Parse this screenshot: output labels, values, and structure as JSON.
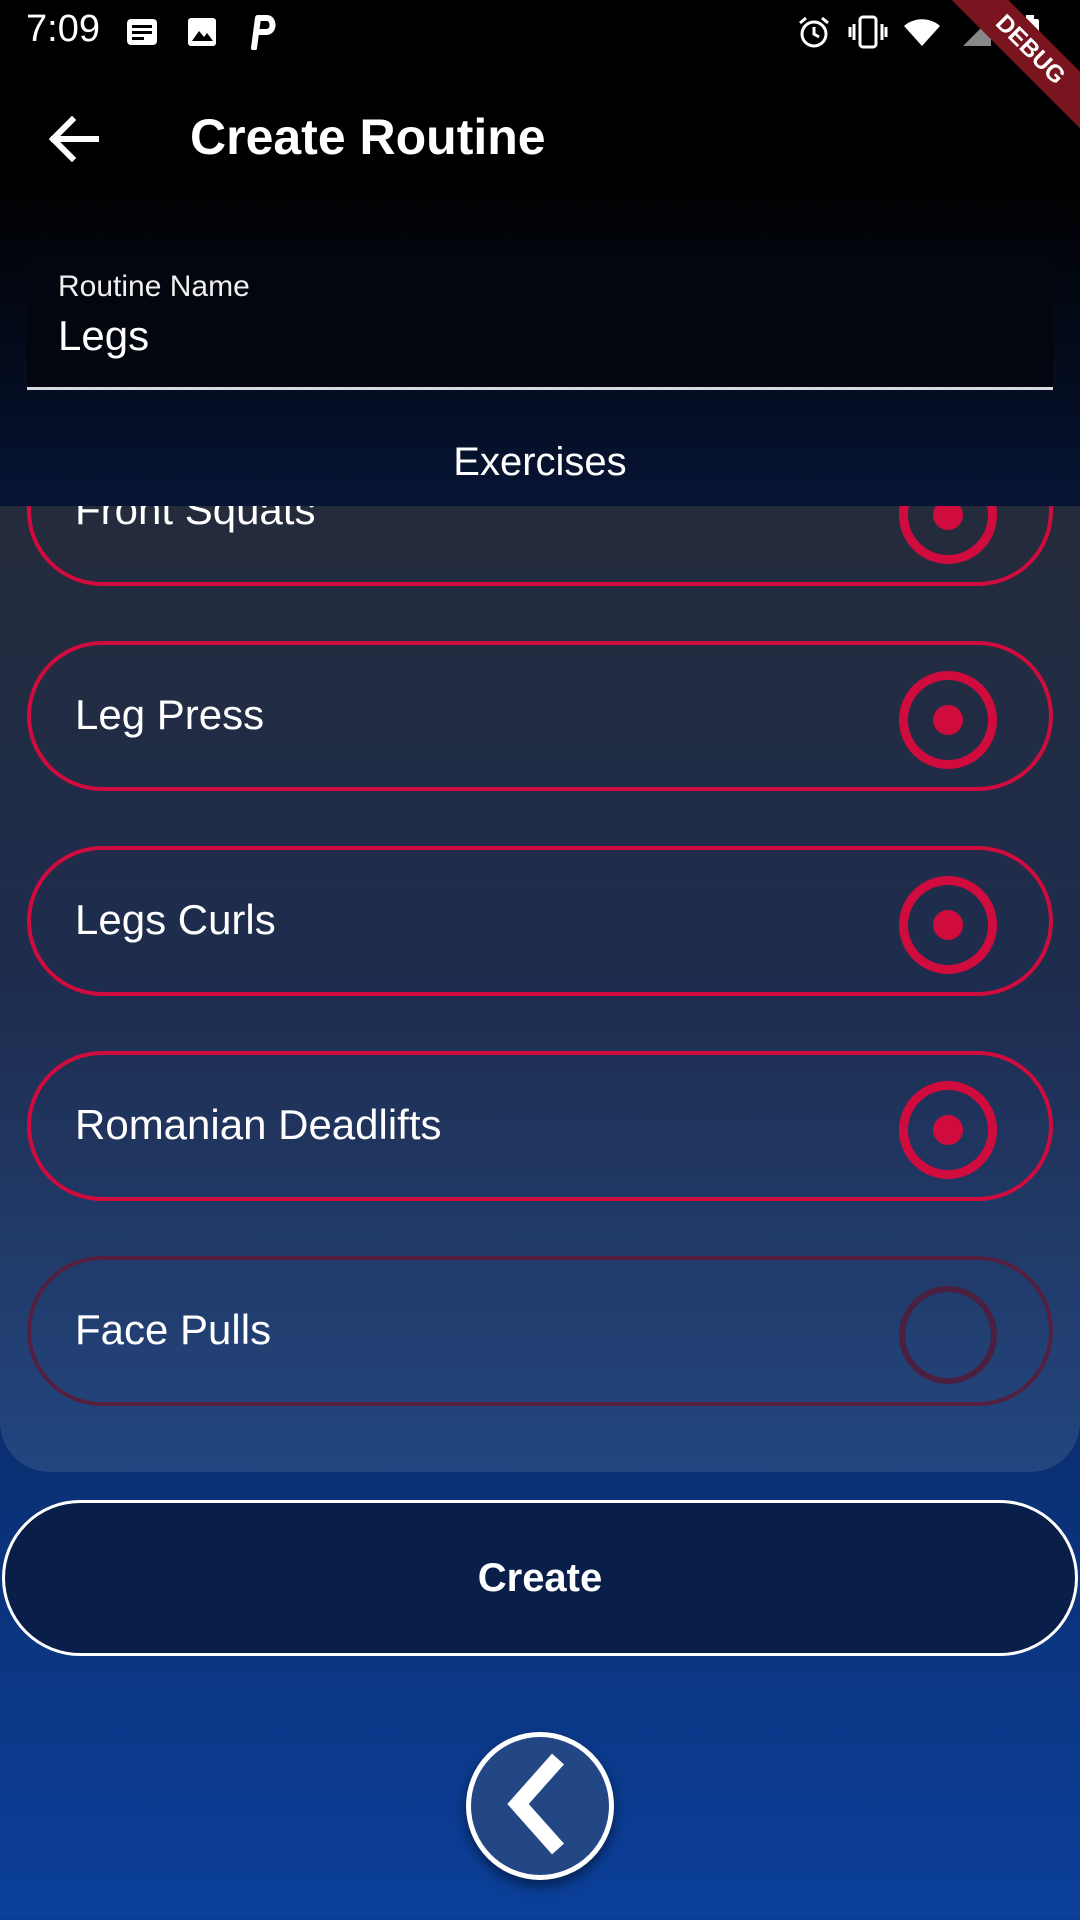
{
  "status_bar": {
    "time": "7:09",
    "left_icons": [
      "news-icon",
      "image-icon",
      "parking-app-icon"
    ],
    "right_icons": [
      "alarm-icon",
      "vibrate-icon",
      "wifi-icon",
      "signal-icon",
      "battery-icon"
    ],
    "debug_banner": "DEBUG"
  },
  "app_bar": {
    "back_icon": "arrow-left-icon",
    "title": "Create Routine"
  },
  "routine_name_field": {
    "label": "Routine Name",
    "value": "Legs"
  },
  "exercises_section": {
    "title": "Exercises",
    "items": [
      {
        "label": "Front Squats",
        "selected": true
      },
      {
        "label": "Leg Press",
        "selected": true
      },
      {
        "label": "Legs Curls",
        "selected": true
      },
      {
        "label": "Romanian Deadlifts",
        "selected": true
      },
      {
        "label": "Face Pulls",
        "selected": false
      }
    ]
  },
  "create_button": {
    "label": "Create"
  },
  "floating_button": {
    "icon": "chevron-left-icon"
  },
  "colors": {
    "accent": "#cf0c3d",
    "unselected_border": "#55203f",
    "button_fill": "#0a1e4a",
    "fab_fill": "#234785"
  }
}
